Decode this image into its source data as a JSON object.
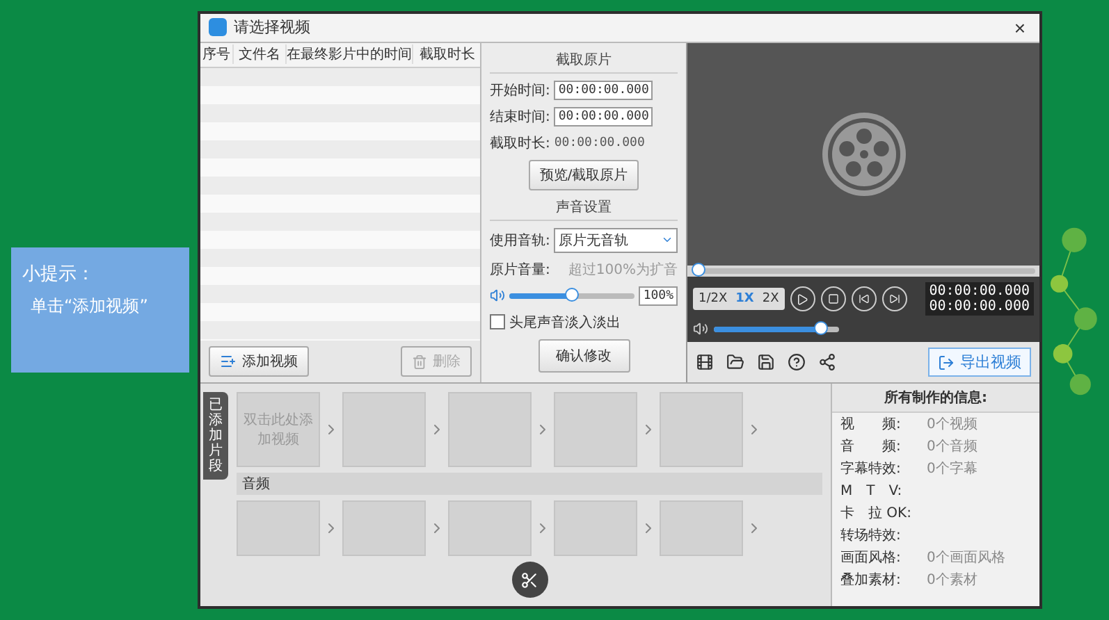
{
  "tip": {
    "title": "小提示：",
    "body": "单击“添加视频”"
  },
  "dialog": {
    "title": "请选择视频",
    "close": "×",
    "columns": [
      "序号",
      "文件名",
      "在最终影片中的时间",
      "截取时长"
    ],
    "add_button": "添加视频",
    "delete_button": {
      "label": "删除",
      "disabled": true
    }
  },
  "clip_panel": {
    "heading": "截取原片",
    "start_label": "开始时间:",
    "start_value": "00:00:00.000",
    "end_label": "结束时间:",
    "end_value": "00:00:00.000",
    "duration_label": "截取时长:",
    "duration_value": "00:00:00.000",
    "preview_button": "预览/截取原片"
  },
  "sound": {
    "heading": "声音设置",
    "track_label": "使用音轨:",
    "track_value": "原片无音轨",
    "volume_label": "原片音量:",
    "volume_hint": "超过100%为扩音",
    "volume": {
      "level": 0.5,
      "value": "100%"
    },
    "fade": {
      "label": "头尾声音淡入淡出",
      "checked": false
    },
    "confirm_button": "确认修改"
  },
  "player": {
    "progress": {
      "level": 0
    },
    "speeds": [
      {
        "label": "1/2X",
        "selected": false
      },
      {
        "label": "1X",
        "selected": true
      },
      {
        "label": "2X",
        "selected": false
      }
    ],
    "current_time": "00:00:00.000",
    "total_time": "00:00:00.000",
    "volume": {
      "level": 0.85
    },
    "export_button": "导出视频"
  },
  "timeline": {
    "tab": "已添加片段",
    "placeholder_clip": "双击此处添加视频",
    "audio_label": "音频"
  },
  "info": {
    "title": "所有制作的信息:",
    "rows": [
      {
        "label": "视　　频:",
        "value": "0个视频"
      },
      {
        "label": "音　　频:",
        "value": "0个音频"
      },
      {
        "label": "字幕特效:",
        "value": "0个字幕"
      },
      {
        "label": "M　T　V:"
      },
      {
        "label": "卡　拉 OK:"
      },
      {
        "label": "转场特效:"
      },
      {
        "label": "画面风格:",
        "value": "0个画面风格"
      },
      {
        "label": "叠加素材:",
        "value": "0个素材"
      }
    ]
  }
}
